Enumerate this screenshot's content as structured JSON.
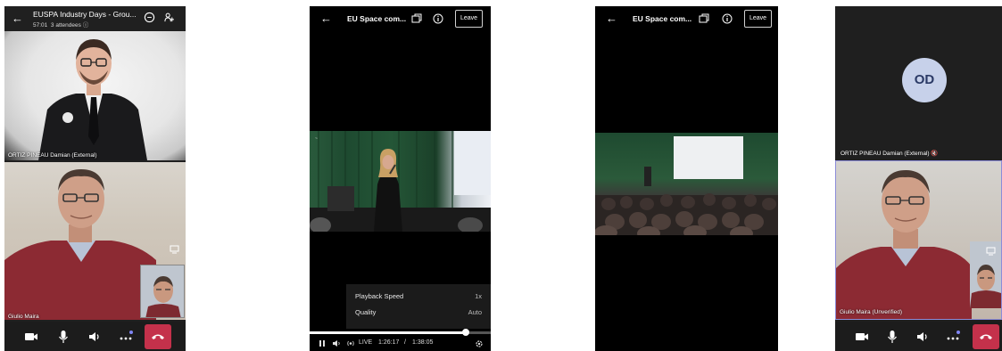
{
  "panel1": {
    "title": "EUSPA Industry Days - Grou...",
    "time": "57:01",
    "attendees": "3 attendees",
    "top_participant": "ORTIZ PINEAU Damian (External)",
    "bottom_participant": "Giulio Maira"
  },
  "panel2": {
    "title": "EU Space com...",
    "leave_label": "Leave",
    "menu": [
      {
        "label": "Playback Speed",
        "value": "1x"
      },
      {
        "label": "Quality",
        "value": "Auto"
      }
    ],
    "live_label": "LIVE",
    "current_time": "1:26:17",
    "separator": "/",
    "duration": "1:38:05",
    "progress": 0.86
  },
  "panel3": {
    "title": "EU Space com...",
    "leave_label": "Leave"
  },
  "panel4": {
    "avatar_initials": "OD",
    "top_participant": "ORTIZ PINEAU Damian (External)",
    "bottom_participant": "Giulio Maira (Unverified)"
  },
  "colors": {
    "hangup": "#c4314b",
    "active_speaker_border": "#8c8cd8",
    "avatar_bg": "#c7d1ea"
  }
}
